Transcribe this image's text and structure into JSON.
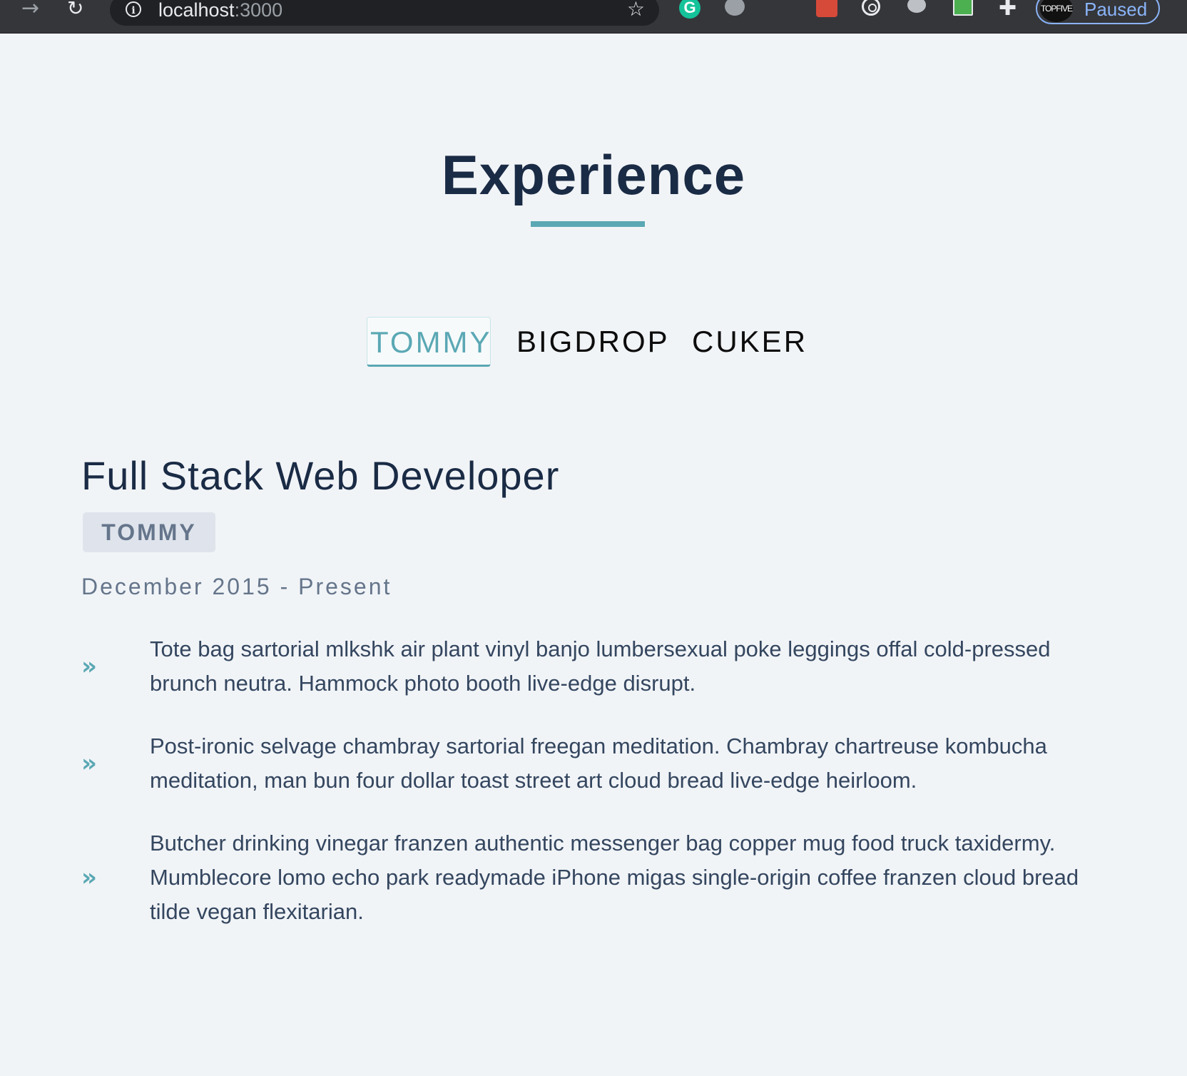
{
  "browser": {
    "url_host": "localhost",
    "url_port": ":3000",
    "profile_status": "Paused",
    "profile_avatar_text": "TOPFIVE",
    "grammarly_letter": "G",
    "icons": {
      "forward": "arrow-right-icon",
      "reload": "reload-icon",
      "info": "info-icon",
      "bookmark": "star-icon",
      "extensions": "puzzle-icon"
    }
  },
  "section": {
    "title": "Experience"
  },
  "tabs": [
    {
      "label": "TOMMY",
      "active": true
    },
    {
      "label": "BIGDROP",
      "active": false
    },
    {
      "label": "CUKER",
      "active": false
    }
  ],
  "job": {
    "title": "Full Stack Web Developer",
    "company": "TOMMY",
    "dates": "December 2015 - Present",
    "duties": [
      "Tote bag sartorial mlkshk air plant vinyl banjo lumbersexual poke leggings offal cold-pressed brunch neutra. Hammock photo booth live-edge disrupt.",
      "Post-ironic selvage chambray sartorial freegan meditation. Chambray chartreuse kombucha meditation, man bun four dollar toast street art cloud bread live-edge heirloom.",
      "Butcher drinking vinegar franzen authentic messenger bag copper mug food truck taxidermy. Mumblecore lomo echo park readymade iPhone migas single-origin coffee franzen cloud bread tilde vegan flexitarian."
    ]
  },
  "colors": {
    "accent": "#5aa8b4",
    "heading": "#1a2b45",
    "muted": "#65758b",
    "background": "#f1f4f7"
  }
}
